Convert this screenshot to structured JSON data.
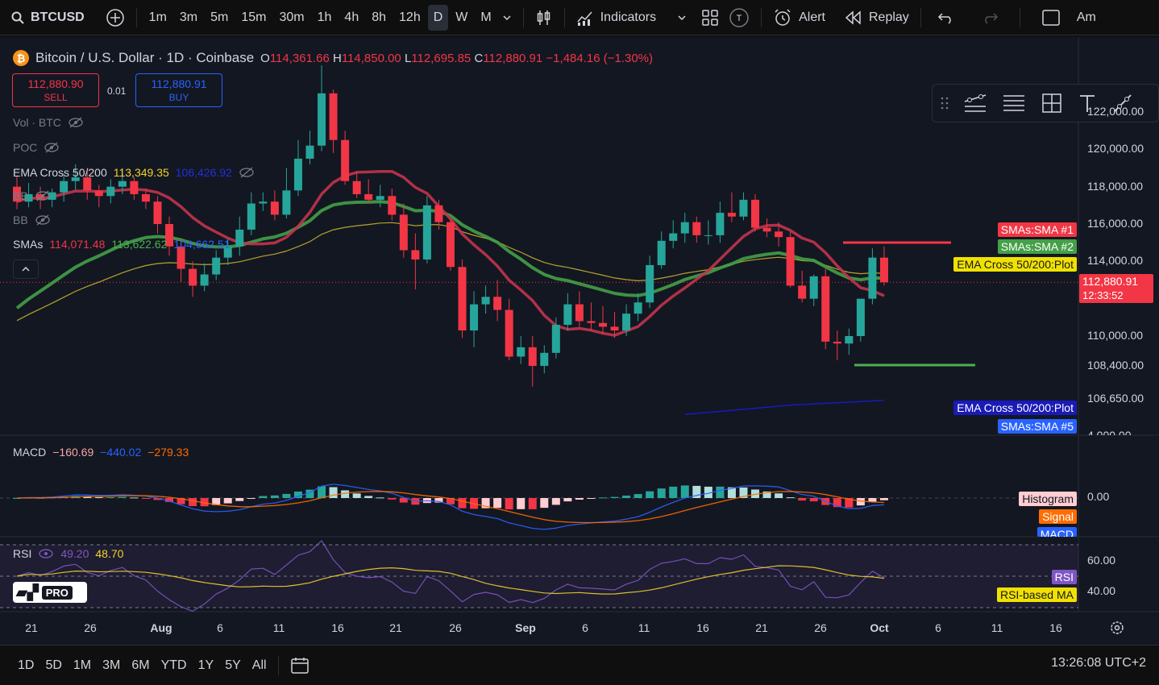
{
  "toolbar": {
    "symbol": "BTCUSD",
    "intervals": [
      "1m",
      "3m",
      "5m",
      "15m",
      "30m",
      "1h",
      "4h",
      "8h",
      "12h",
      "D",
      "W",
      "M"
    ],
    "active_interval": "D",
    "indicators_label": "Indicators",
    "alert_label": "Alert",
    "replay_label": "Replay",
    "truncated_label": "Am"
  },
  "legend": {
    "title": "Bitcoin / U.S. Dollar · 1D · Coinbase",
    "o": "114,361.66",
    "h": "114,850.00",
    "l": "112,695.85",
    "c": "112,880.91",
    "change": "−1,484.16 (−1.30%)"
  },
  "trade": {
    "sell_price": "112,880.90",
    "sell_label": "SELL",
    "qty": "0.01",
    "buy_price": "112,880.91",
    "buy_label": "BUY"
  },
  "indicators": {
    "vol": "Vol · BTC",
    "poc": "POC",
    "ema_name": "EMA Cross 50/200",
    "ema_v1": "113,349.35",
    "ema_v2": "106,426.92",
    "bb1": "BB",
    "bb2": "BB",
    "smas_name": "SMAs",
    "sma_v1": "114,071.48",
    "sma_v2": "113,622.62",
    "sma_v3": "104,662.51",
    "macd_name": "MACD",
    "macd_v1": "−160.69",
    "macd_v2": "−440.02",
    "macd_v3": "−279.33",
    "rsi_name": "RSI",
    "rsi_v1": "49.20",
    "rsi_v2": "48.70"
  },
  "price_axis": [
    "122,000.00",
    "120,000.00",
    "118,000.00",
    "116,000.00",
    "114,000.00",
    "110,000.00",
    "108,400.00",
    "106,650.00"
  ],
  "macd_axis": [
    "0.00"
  ],
  "rsi_axis": [
    "60.00",
    "40.00"
  ],
  "truncated_axis_label": "4,000.00",
  "last_price": {
    "price": "112,880.91",
    "countdown": "12:33:52"
  },
  "tags": {
    "sma1": "SMAs:SMA #1",
    "sma2": "SMAs:SMA #2",
    "ema_plot_yellow": "EMA Cross 50/200:Plot",
    "ema_plot_blue": "EMA Cross 50/200:Plot",
    "sma5": "SMAs:SMA #5",
    "histogram": "Histogram",
    "signal": "Signal",
    "macd": "MACD",
    "rsi": "RSI",
    "rsi_ma": "RSI-based MA"
  },
  "time_axis": [
    "21",
    "26",
    "Aug",
    "6",
    "11",
    "16",
    "21",
    "26",
    "Sep",
    "6",
    "11",
    "16",
    "21",
    "26",
    "Oct",
    "6",
    "11",
    "16"
  ],
  "bottom": {
    "ranges": [
      "1D",
      "5D",
      "1M",
      "3M",
      "6M",
      "YTD",
      "1Y",
      "5Y",
      "All"
    ],
    "clock": "13:26:08 UTC+2"
  },
  "logo_text": "PRO",
  "colors": {
    "up": "#26a69a",
    "down": "#f23645",
    "sma1": "#c2344d",
    "sma2": "#43a047",
    "ema": "#c9b32c",
    "ema200": "#1a1ab8",
    "macd": "#2962ff",
    "signal": "#ff6d00",
    "rsi": "#7e57c2"
  },
  "chart_data": {
    "type": "candlestick",
    "x": [
      "Jul 18",
      "Jul 19",
      "Jul 20",
      "Jul 21",
      "Jul 22",
      "Jul 23",
      "Jul 24",
      "Jul 25",
      "Jul 26",
      "Jul 27",
      "Jul 28",
      "Jul 29",
      "Jul 30",
      "Jul 31",
      "Aug 1",
      "Aug 2",
      "Aug 3",
      "Aug 4",
      "Aug 5",
      "Aug 6",
      "Aug 7",
      "Aug 8",
      "Aug 9",
      "Aug 10",
      "Aug 11",
      "Aug 12",
      "Aug 13",
      "Aug 14",
      "Aug 15",
      "Aug 16",
      "Aug 17",
      "Aug 18",
      "Aug 19",
      "Aug 20",
      "Aug 21",
      "Aug 22",
      "Aug 23",
      "Aug 24",
      "Aug 25",
      "Aug 26",
      "Aug 27",
      "Aug 28",
      "Aug 29",
      "Aug 30",
      "Aug 31",
      "Sep 1",
      "Sep 2",
      "Sep 3",
      "Sep 4",
      "Sep 5",
      "Sep 6",
      "Sep 7",
      "Sep 8",
      "Sep 9",
      "Sep 10",
      "Sep 11",
      "Sep 12",
      "Sep 13",
      "Sep 14",
      "Sep 15",
      "Sep 16",
      "Sep 17",
      "Sep 18",
      "Sep 19",
      "Sep 20",
      "Sep 21",
      "Sep 22",
      "Sep 23",
      "Sep 24",
      "Sep 25",
      "Sep 26",
      "Sep 27",
      "Sep 28",
      "Sep 29",
      "Sep 30"
    ],
    "open": [
      118000,
      117200,
      117600,
      117300,
      117700,
      118300,
      118500,
      117800,
      117500,
      118000,
      118300,
      117600,
      117200,
      116000,
      114800,
      113600,
      112700,
      113300,
      114200,
      114800,
      115700,
      117100,
      117200,
      116500,
      117800,
      119500,
      120200,
      123000,
      120500,
      118300,
      117600,
      117300,
      117500,
      116500,
      114600,
      114100,
      117000,
      116100,
      113700,
      110300,
      111700,
      112100,
      111400,
      108900,
      109400,
      108400,
      109100,
      110600,
      111700,
      110800,
      110700,
      110500,
      110300,
      111200,
      111800,
      113800,
      115100,
      115500,
      116100,
      115400,
      115400,
      116600,
      116400,
      117300,
      115800,
      115600,
      115300,
      112700,
      112000,
      113200,
      109700,
      109600,
      110000,
      112000,
      114200
    ],
    "close": [
      117200,
      117600,
      117300,
      117700,
      118300,
      118500,
      117800,
      117500,
      118000,
      118300,
      117600,
      117200,
      116000,
      114800,
      113600,
      112700,
      113300,
      114200,
      114800,
      115700,
      117100,
      117200,
      116500,
      117800,
      119500,
      120200,
      123000,
      120500,
      118300,
      117600,
      117300,
      117500,
      116500,
      114600,
      114100,
      117000,
      116100,
      113700,
      110300,
      111700,
      112100,
      111400,
      108900,
      109400,
      108400,
      109100,
      110600,
      111700,
      110800,
      110700,
      110500,
      110300,
      111200,
      111800,
      113800,
      115100,
      115500,
      116100,
      115400,
      115400,
      116600,
      116400,
      117300,
      115800,
      115600,
      115300,
      112700,
      112000,
      113200,
      109700,
      109600,
      110000,
      112000,
      114200,
      112880
    ],
    "high": [
      118600,
      118200,
      118000,
      117900,
      118700,
      119200,
      119000,
      118100,
      118400,
      119000,
      118500,
      117900,
      117500,
      116400,
      115200,
      114000,
      113900,
      114600,
      115200,
      116400,
      117700,
      117700,
      117800,
      119000,
      120500,
      121000,
      124500,
      123200,
      121000,
      118800,
      118400,
      118100,
      117900,
      117100,
      115500,
      117500,
      117300,
      116300,
      114100,
      112400,
      112700,
      113000,
      112000,
      110000,
      110000,
      109500,
      111000,
      112300,
      112400,
      111800,
      111600,
      111300,
      111700,
      112300,
      114300,
      115600,
      116200,
      116600,
      116400,
      116200,
      117200,
      117700,
      117700,
      117600,
      116300,
      116100,
      115600,
      113500,
      113300,
      113600,
      110300,
      110400,
      111400,
      114700,
      114800
    ],
    "low": [
      116800,
      116900,
      116800,
      116900,
      117200,
      117800,
      117300,
      116900,
      117100,
      117600,
      117300,
      116800,
      115500,
      114300,
      112900,
      112100,
      112400,
      113000,
      113800,
      114300,
      115400,
      116700,
      116200,
      116300,
      117500,
      119200,
      119900,
      119800,
      118100,
      117400,
      117100,
      116900,
      116200,
      114200,
      112500,
      113900,
      115700,
      113500,
      109900,
      109400,
      111200,
      110800,
      108700,
      108500,
      107300,
      108000,
      108800,
      110300,
      110500,
      110300,
      110100,
      109900,
      110000,
      110800,
      111500,
      113600,
      114700,
      115000,
      115000,
      114900,
      115000,
      116100,
      116200,
      115600,
      115300,
      114800,
      112600,
      111800,
      111600,
      109300,
      108700,
      109000,
      109700,
      111700,
      112700
    ]
  }
}
